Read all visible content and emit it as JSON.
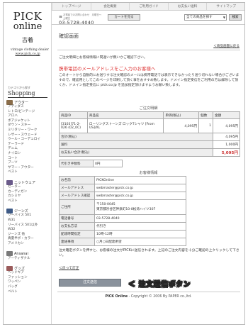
{
  "sidebar": {
    "logo_line1": "PICK",
    "logo_line2": "online",
    "logo_kanji": "古着",
    "tagline1": "vintage clothing dealer",
    "tagline2": "www.pick.co.jp",
    "shopping_jp": "カテゴリから探す",
    "shopping_en": "Shopping",
    "categories": [
      {
        "name": "アウター",
        "color": "#8a6d4a",
        "items": [
          "アディダス",
          "レトロ/ビンテージ",
          "アロハ",
          "ボアジャケット",
          "ダウン・スキー",
          "ミリタリー・ワーク",
          "レザー・スウェード",
          "ウール・コーデュロイ",
          "テーラード",
          "デニム",
          "ナイロン",
          "コート",
          "ブーツ",
          "サマー・アウター",
          "ベスト"
        ]
      },
      {
        "name": "ニットウェア",
        "color": "#6a5a8a",
        "items": [
          "セーター",
          "カーディガン",
          "カシミヤ",
          "ベスト"
        ]
      },
      {
        "name": "ジーンズ",
        "color": "#3e5a86",
        "items": [
          "リーバイス 501",
          "W31",
          "リーバイス 501以外",
          "W32",
          "ジーンズ 他",
          "真夏半ボ・カラー",
          "アメリカン"
        ]
      },
      {
        "name": "Ansanai",
        "color": "#7a7a7a",
        "items": [
          "アーティザナル"
        ]
      },
      {
        "name": "グッズ",
        "color": "#9a5a5a",
        "items": [
          "ヘッドギア",
          "ファッション",
          "ワッペン",
          "バッグ",
          "ベルト"
        ]
      }
    ]
  },
  "topnav": [
    "トップページ",
    "会社概要",
    "ご利用ガイド",
    "お支払い送料",
    "サイトマップ"
  ],
  "header": {
    "tel_note": "お電話でのお問い合わせ　月曜日〜土曜日",
    "tel": "03-5728-4040",
    "cart_label": "カートを見る",
    "search_option": "全ての商品を探す",
    "search_button": "検索"
  },
  "main": {
    "title": "確認画面",
    "back_link": "＜商品画面に戻る",
    "intro": "ご注文明細とお客様情報に間違いが無いかご確認下さい。",
    "mobile_head": "携帯電話のメールアドレスをご入力のお客様へ",
    "mobile_text": "このオートから自動的にお送りする注文確認のメールは携帯電話では表示できなかったり送り切れない場合がございますので、確認用としてこのページを印刷して頂く事をおすすめ致します。ドメイン指定受信をご利用の方は解除して頂くか、ドメイン指定受信に pick.co.jp を追加指定頂けますようお願い致します。",
    "order_caption": "ご注文明細",
    "order_headers": [
      "商品ID",
      "商品名",
      "単価(税込)",
      "個数",
      "金額"
    ],
    "order_rows": [
      {
        "id": "[3103]71-2-026 (02_0C)",
        "name": "ローリングストーンズ ロックTシャツ [From US]/XL",
        "price": "4,095円",
        "qty": "1",
        "amount": "4,095円"
      }
    ],
    "subtotal_label": "合計(税込)",
    "subtotal_value": "4,095円",
    "shipping_label": "送料",
    "shipping_value": "1,000円",
    "total_label": "お支払い合計(税込)",
    "total_value": "5,095円",
    "cod_label": "代引き手数料",
    "cod_value": "0円",
    "cust_caption": "お客様情報",
    "customer": [
      {
        "label": "お名前",
        "value": "PICKOnline"
      },
      {
        "label": "メールアドレス",
        "value": "webmaster@pick.co.jp"
      },
      {
        "label": "メールアドレス確認",
        "value": "webmaster@pick.co.jp"
      },
      {
        "label": "ご住所",
        "value": "〒150-0045\n東京都渋谷区神泉町10-8松涛ハイツ307"
      },
      {
        "label": "電話番号",
        "value": "03-5728-4040"
      },
      {
        "label": "お支払方法",
        "value": "代引き"
      },
      {
        "label": "配達時間指定",
        "value": "10時-12時"
      },
      {
        "label": "連絡事項",
        "value": "○月○日配達希望"
      }
    ],
    "note": "注文確定ボタンを押すと、お客様の注文がPICKに送信されます。上記のご注文内容を十分ご確認の上クリックして下さい。",
    "back2": "＜戻って訂正",
    "submit_label": "注文送信",
    "callout": "＜ 注文送信ボタン",
    "footer_brand": "PICK Online",
    "footer_rest": " - Copyright © 2006 By PAPER co.,ltd."
  }
}
